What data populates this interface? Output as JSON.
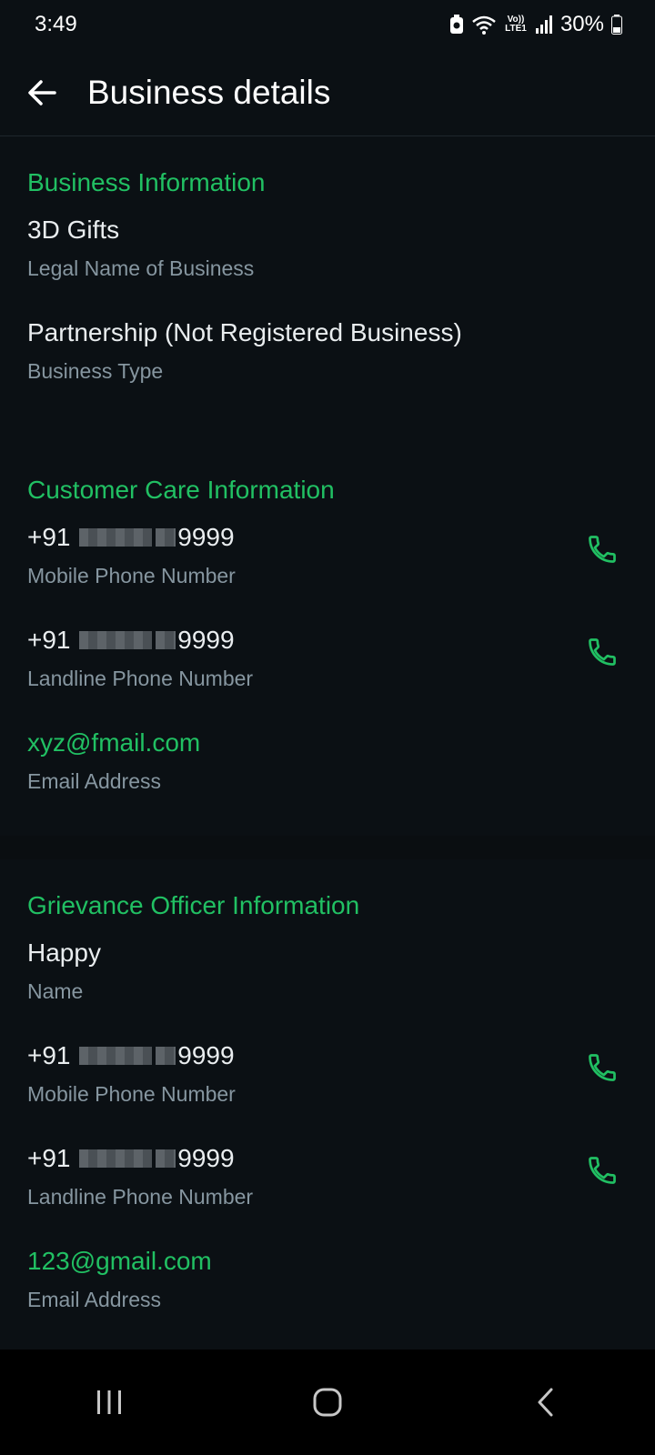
{
  "status_bar": {
    "time": "3:49",
    "battery": "30%",
    "network_label": "Vo)) LTE1"
  },
  "app_bar": {
    "title": "Business details"
  },
  "sections": {
    "business": {
      "title": "Business Information",
      "items": [
        {
          "value": "3D Gifts",
          "label": "Legal Name of Business"
        },
        {
          "value": "Partnership (Not Registered Business)",
          "label": "Business Type"
        }
      ]
    },
    "customer_care": {
      "title": "Customer Care Information",
      "mobile": {
        "prefix": "+91",
        "suffix": "9999",
        "label": "Mobile Phone Number"
      },
      "landline": {
        "prefix": "+91",
        "suffix": "9999",
        "label": "Landline Phone Number"
      },
      "email": {
        "value": "xyz@fmail.com",
        "label": "Email Address"
      }
    },
    "grievance": {
      "title": "Grievance Officer Information",
      "name": {
        "value": "Happy",
        "label": "Name"
      },
      "mobile": {
        "prefix": "+91",
        "suffix": "9999",
        "label": "Mobile Phone Number"
      },
      "landline": {
        "prefix": "+91",
        "suffix": "9999",
        "label": "Landline Phone Number"
      },
      "email": {
        "value": "123@gmail.com",
        "label": "Email Address"
      }
    }
  },
  "colors": {
    "accent": "#21c063",
    "background": "#0b1014",
    "secondary_text": "#8696a0"
  },
  "icons": {
    "back": "arrow-left-icon",
    "call": "phone-icon",
    "nav_recents": "recent-apps-icon",
    "nav_home": "home-icon",
    "nav_back": "chevron-left-icon"
  }
}
